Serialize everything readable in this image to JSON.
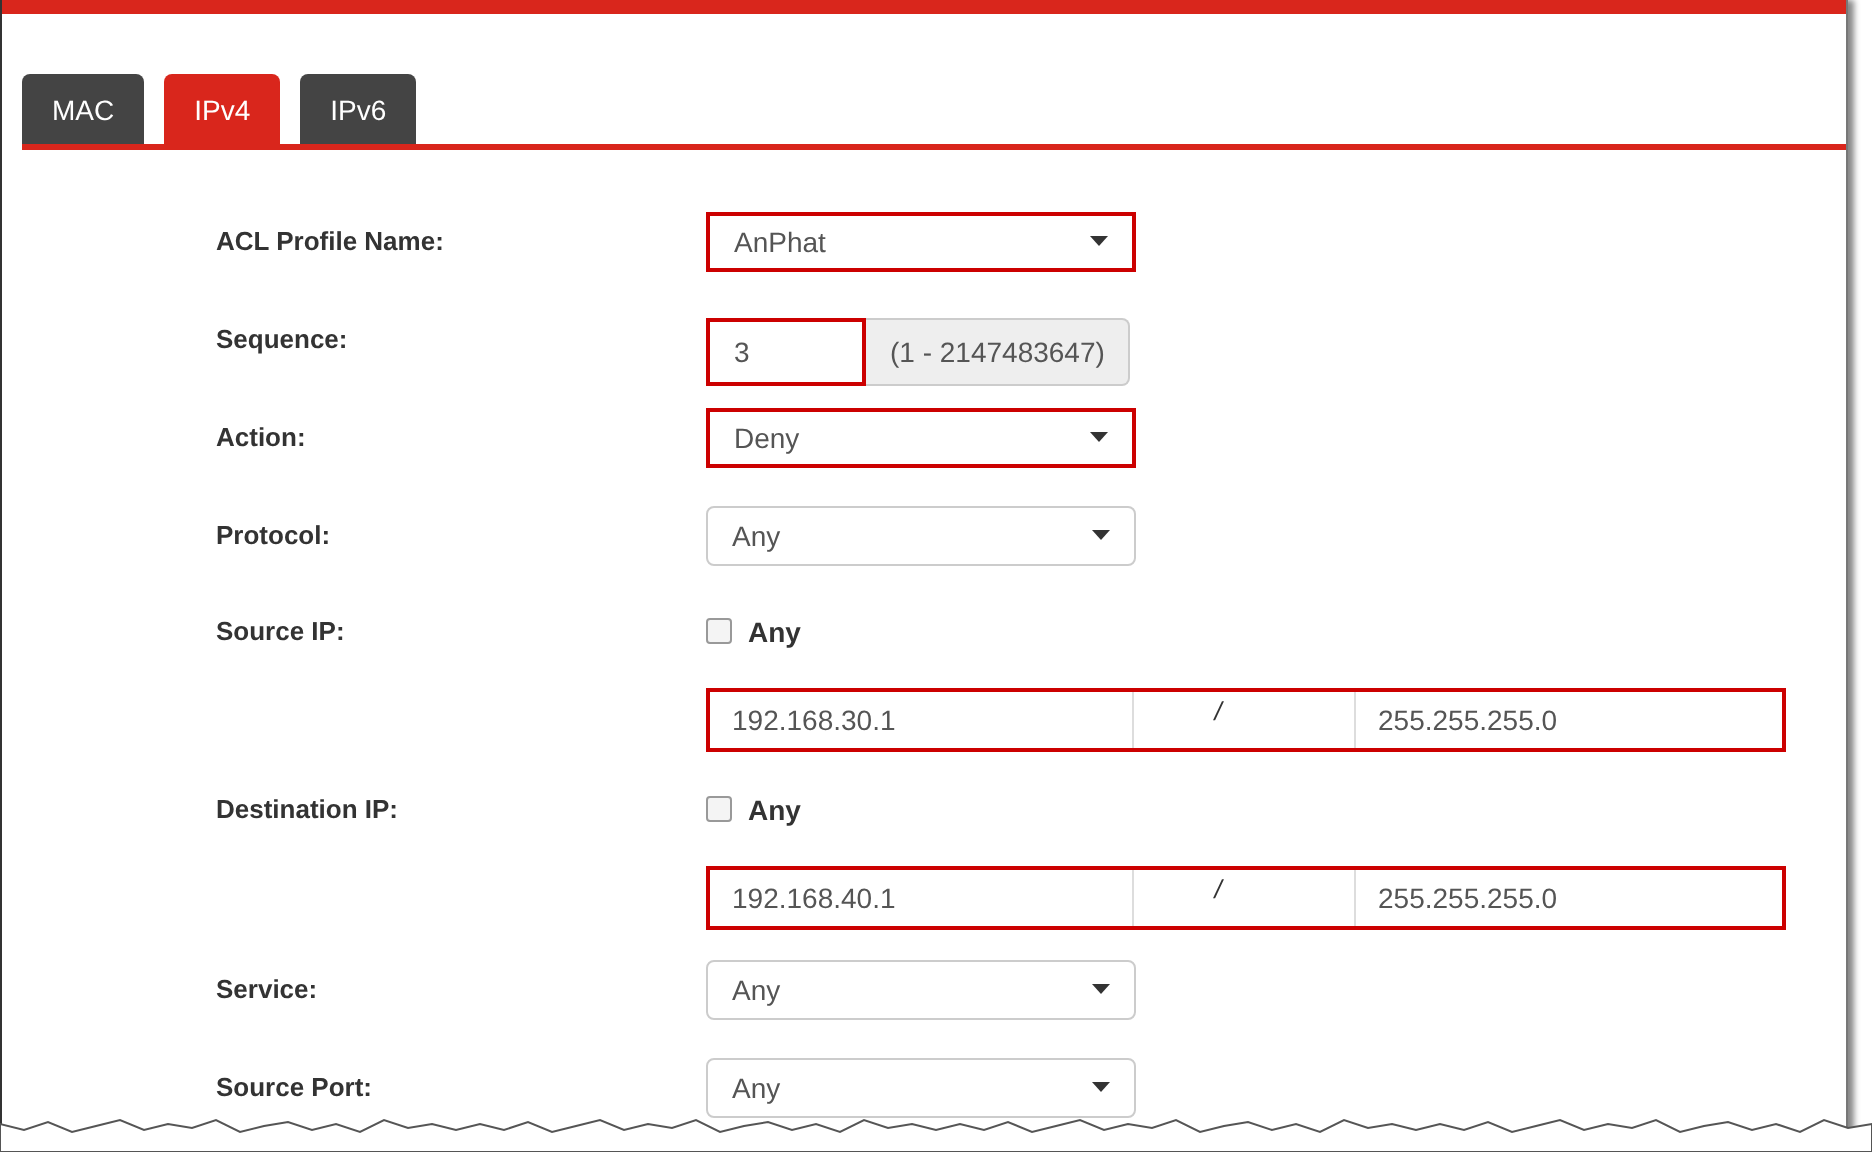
{
  "tabs": [
    {
      "label": "MAC",
      "selected": false
    },
    {
      "label": "IPv4",
      "selected": true
    },
    {
      "label": "IPv6",
      "selected": false
    }
  ],
  "form": [
    {
      "kind": "select",
      "label": "ACL Profile Name:",
      "value": "AnPhat",
      "highlighted": true
    },
    {
      "kind": "number",
      "label": "Sequence:",
      "value": "3",
      "addon": "(1 - 2147483647)",
      "highlighted": true
    },
    {
      "kind": "select",
      "label": "Action:",
      "value": "Deny",
      "highlighted": true
    },
    {
      "kind": "select",
      "label": "Protocol:",
      "value": "Any",
      "highlighted": false
    },
    {
      "kind": "checkbox",
      "label": "Source IP:",
      "option": "Any",
      "checked": false
    },
    {
      "kind": "ip",
      "address": "192.168.30.1",
      "separator": "/",
      "mask": "255.255.255.0",
      "highlighted": true
    },
    {
      "kind": "checkbox",
      "label": "Destination IP:",
      "option": "Any",
      "checked": false
    },
    {
      "kind": "ip",
      "address": "192.168.40.1",
      "separator": "/",
      "mask": "255.255.255.0",
      "highlighted": true
    },
    {
      "kind": "select",
      "label": "Service:",
      "value": "Any",
      "highlighted": false
    },
    {
      "kind": "select",
      "label": "Source Port:",
      "value": "Any",
      "highlighted": false
    }
  ]
}
